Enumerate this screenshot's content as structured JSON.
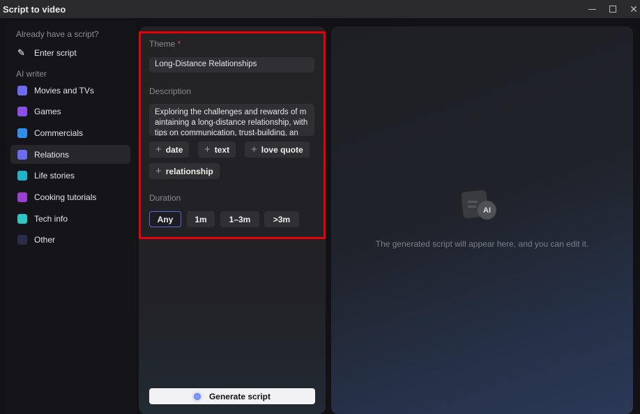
{
  "window": {
    "title": "Script to video"
  },
  "sidebar": {
    "existing_heading": "Already have a script?",
    "enter_script": "Enter script",
    "ai_heading": "AI writer",
    "items": [
      {
        "label": "Movies and TVs",
        "icon": "clapperboard-icon",
        "color": "#6b6cf0"
      },
      {
        "label": "Games",
        "icon": "gamepad-icon",
        "color": "#8b4ee8"
      },
      {
        "label": "Commercials",
        "icon": "presentation-icon",
        "color": "#2f8fe8"
      },
      {
        "label": "Relations",
        "icon": "people-icon",
        "color": "#6b6cf0",
        "active": true
      },
      {
        "label": "Life stories",
        "icon": "person-waving-icon",
        "color": "#21b1c8"
      },
      {
        "label": "Cooking tutorials",
        "icon": "cocktail-icon",
        "color": "#9b3fd0"
      },
      {
        "label": "Tech info",
        "icon": "rocket-icon",
        "color": "#2ec5c5"
      },
      {
        "label": "Other",
        "icon": "document-icon",
        "color": "#2a2d4a"
      }
    ]
  },
  "form": {
    "theme_label": "Theme",
    "required_mark": "*",
    "theme_value": "Long-Distance Relationships",
    "description_label": "Description",
    "description_value": "Exploring the challenges and rewards of maintaining a long-distance relationship, with tips on communication, trust-building, an",
    "tags": [
      "date",
      "text",
      "love quote",
      "relationship"
    ],
    "duration_label": "Duration",
    "durations": [
      "Any",
      "1m",
      "1–3m",
      ">3m"
    ],
    "selected_duration": "Any",
    "generate": "Generate script"
  },
  "preview": {
    "icon_badge": "AI",
    "placeholder": "The generated script will appear here, and you can edit it."
  }
}
